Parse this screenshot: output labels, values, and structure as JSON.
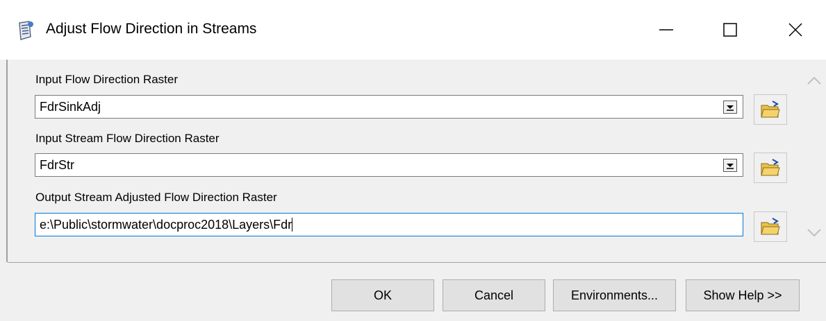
{
  "window": {
    "title": "Adjust Flow Direction in Streams",
    "app_icon": "toolbox-scroll-icon"
  },
  "fields": [
    {
      "label": "Input Flow Direction Raster",
      "value": "FdrSinkAdj",
      "type": "dropdown"
    },
    {
      "label": "Input Stream Flow Direction Raster",
      "value": "FdrStr",
      "type": "dropdown"
    },
    {
      "label": "Output Stream Adjusted Flow Direction Raster",
      "value": "e:\\Public\\stormwater\\docproc2018\\Layers\\Fdr",
      "type": "text"
    }
  ],
  "buttons": {
    "ok": "OK",
    "cancel": "Cancel",
    "environments": "Environments...",
    "show_help": "Show Help >>"
  },
  "colors": {
    "focus_border": "#0078d7",
    "folder_yellow": "#f5d36b"
  }
}
